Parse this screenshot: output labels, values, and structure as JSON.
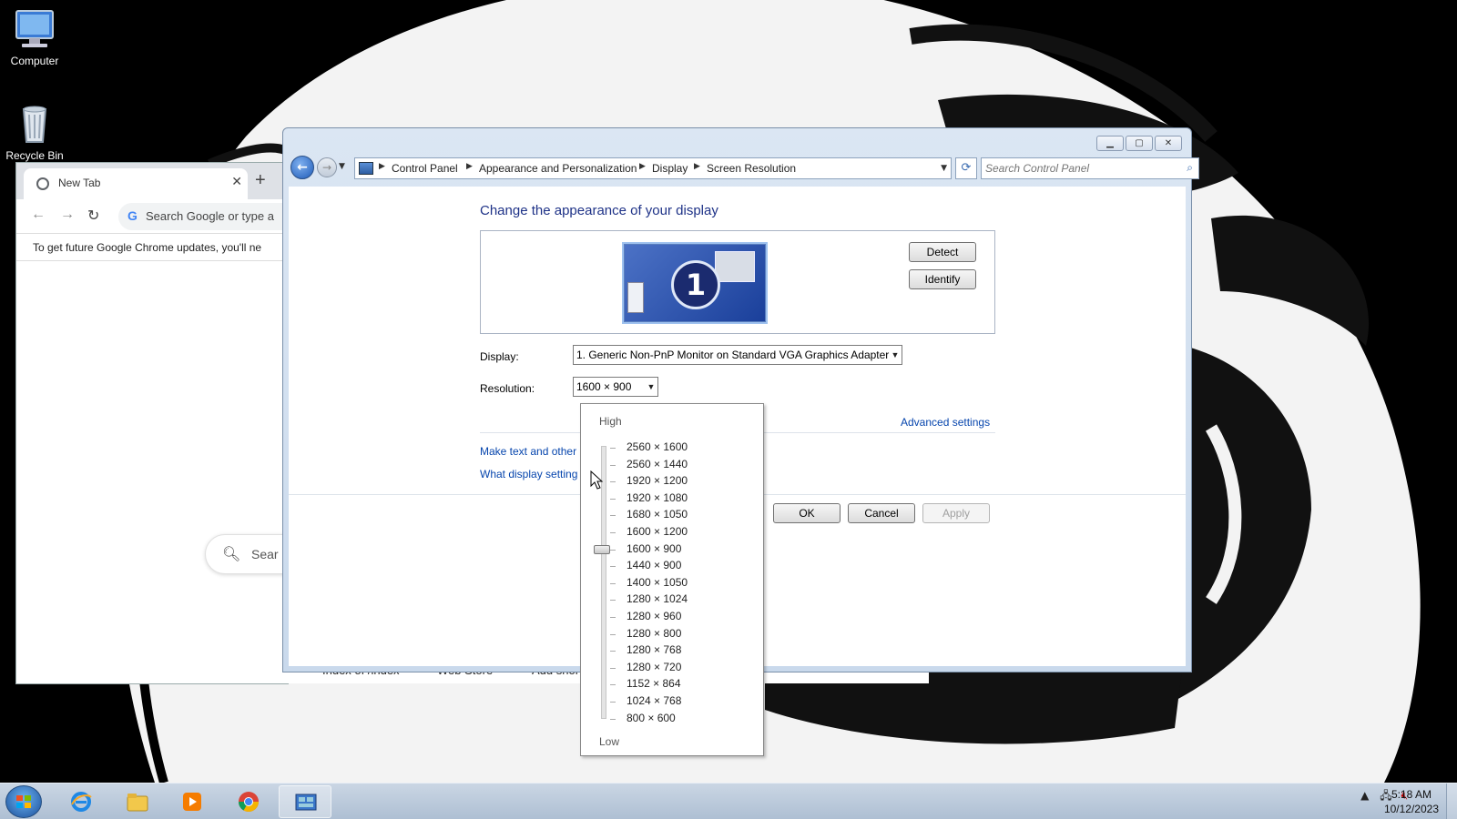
{
  "desktop": {
    "icons": [
      {
        "label": "Computer"
      },
      {
        "label": "Recycle Bin"
      }
    ]
  },
  "chrome": {
    "tab_title": "New Tab",
    "omnibox_placeholder": "Search Google or type a",
    "infobar_text": "To get future Google Chrome updates, you'll ne",
    "ntp_search_text": "Sear",
    "bookmarks": [
      "Index of /index",
      "Web Store",
      "Add shor"
    ]
  },
  "control_panel": {
    "breadcrumbs": [
      "Control Panel",
      "Appearance and Personalization",
      "Display",
      "Screen Resolution"
    ],
    "search_placeholder": "Search Control Panel",
    "heading": "Change the appearance of your display",
    "monitor_number": "1",
    "detect_label": "Detect",
    "identify_label": "Identify",
    "display_label": "Display:",
    "display_value": "1. Generic Non-PnP Monitor on Standard VGA Graphics Adapter",
    "resolution_label": "Resolution:",
    "resolution_value": "1600 × 900",
    "advanced_settings": "Advanced settings",
    "link_text_size": "Make text and other",
    "link_what_settings": "What display setting",
    "ok_label": "OK",
    "cancel_label": "Cancel",
    "apply_label": "Apply"
  },
  "resolution_dropdown": {
    "high_label": "High",
    "low_label": "Low",
    "options": [
      "2560 × 1600",
      "2560 × 1440",
      "1920 × 1200",
      "1920 × 1080",
      "1680 × 1050",
      "1600 × 1200",
      "1600 × 900",
      "1440 × 900",
      "1400 × 1050",
      "1280 × 1024",
      "1280 × 960",
      "1280 × 800",
      "1280 × 768",
      "1280 × 720",
      "1152 × 864",
      "1024 × 768",
      "800 × 600"
    ],
    "selected_index": 6
  },
  "taskbar": {
    "time": "5:18 AM",
    "date": "10/12/2023",
    "pinned": [
      "internet-explorer",
      "windows-explorer",
      "media-player",
      "chrome",
      "control-panel"
    ],
    "active": "control-panel"
  }
}
